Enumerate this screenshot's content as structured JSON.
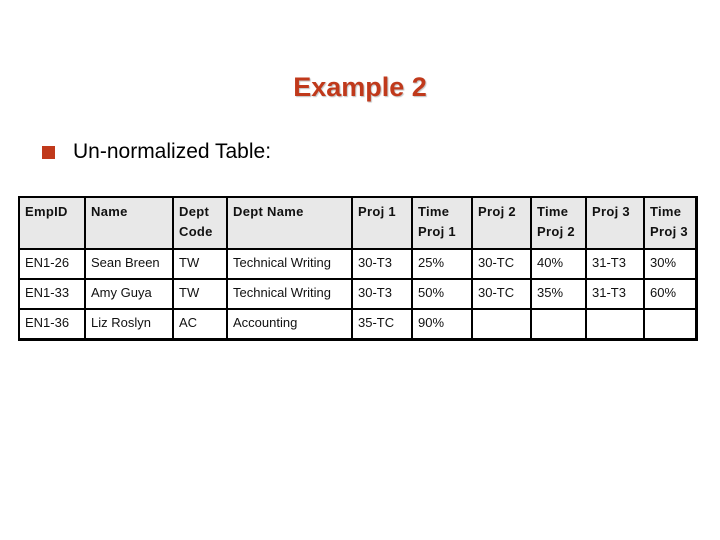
{
  "slide": {
    "title": "Example 2",
    "bullet": "Un-normalized Table:",
    "accent_color": "#c0391b"
  },
  "table": {
    "headers": [
      "EmpID",
      "Name",
      "Dept Code",
      "Dept Name",
      "Proj 1",
      "Time Proj 1",
      "Proj 2",
      "Time Proj 2",
      "Proj 3",
      "Time Proj 3"
    ],
    "rows": [
      [
        "EN1-26",
        "Sean Breen",
        "TW",
        "Technical Writing",
        "30-T3",
        "25%",
        "30-TC",
        "40%",
        "31-T3",
        "30%"
      ],
      [
        "EN1-33",
        "Amy Guya",
        "TW",
        "Technical Writing",
        "30-T3",
        "50%",
        "30-TC",
        "35%",
        "31-T3",
        "60%"
      ],
      [
        "EN1-36",
        "Liz Roslyn",
        "AC",
        "Accounting",
        "35-TC",
        "90%",
        "",
        "",
        "",
        ""
      ]
    ]
  }
}
